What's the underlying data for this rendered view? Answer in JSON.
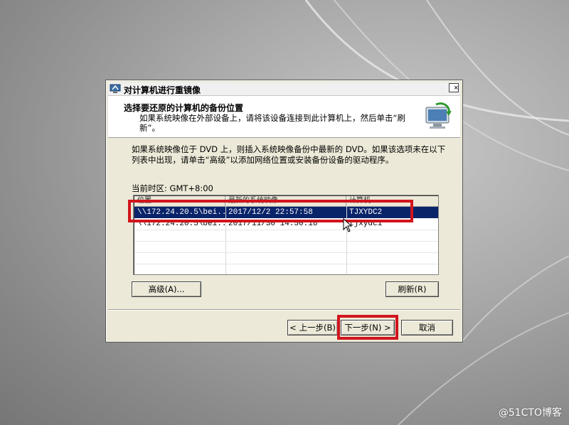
{
  "window": {
    "title": "对计算机进行重镜像",
    "close_label": "×"
  },
  "header": {
    "title": "选择要还原的计算机的备份位置",
    "description": "如果系统映像在外部设备上，请将该设备连接到此计算机上，然后单击“刷新”。"
  },
  "body": {
    "instruction": "如果系统映像位于 DVD 上，则插入系统映像备份中最新的 DVD。如果该选项未在以下列表中出现，请单击“高级”以添加网络位置或安装备份设备的驱动程序。",
    "timezone": "当前时区: GMT+8:00"
  },
  "list": {
    "columns": [
      "位置",
      "最新的系统映像",
      "计算机"
    ],
    "rows": [
      {
        "location": "\\\\172.24.20.5\\bei...",
        "date": "2017/12/2 22:57:58",
        "computer": "TJXYDC2",
        "selected": true
      },
      {
        "location": "\\\\172.24.20.5\\bei...",
        "date": "2017/11/30 14:50:18",
        "computer": "tjxydc1",
        "selected": false
      }
    ]
  },
  "buttons": {
    "advanced": "高级(A)...",
    "refresh": "刷新(R)",
    "back": "< 上一步(B)",
    "next": "下一步(N) >",
    "cancel": "取消"
  },
  "watermark": "@51CTO博客",
  "colors": {
    "highlight": "#d1141d",
    "selection": "#0a246a"
  }
}
